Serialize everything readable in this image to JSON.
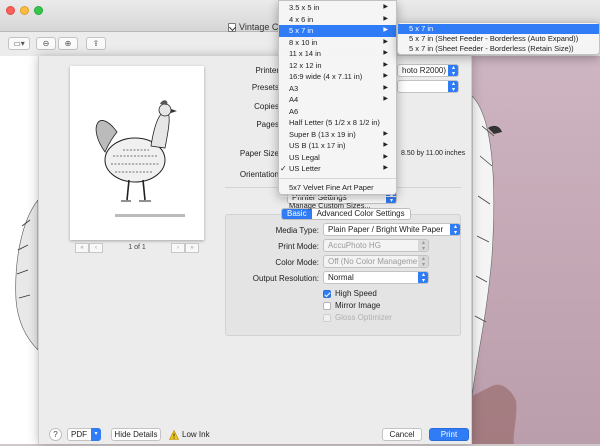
{
  "window": {
    "title": "Vintage Chick",
    "colors": {
      "accent": "#2f7cf6",
      "close": "#fc605c",
      "minimize": "#fdbc40",
      "maximize": "#34c84a"
    }
  },
  "preview": {
    "page_indicator": "1 of 1"
  },
  "form": {
    "printer_label": "Printer",
    "printer_value": "hoto R2000)",
    "presets_label": "Presets",
    "copies_label": "Copies",
    "pages_label": "Pages",
    "paper_size_label": "Paper Size",
    "paper_size_dimensions": "8.50 by 11.00 inches",
    "orientation_label": "Orientation",
    "section_value": "Printer Settings"
  },
  "tabs": {
    "basic": "Basic",
    "advanced": "Advanced Color Settings"
  },
  "settings": {
    "media_type_label": "Media Type:",
    "media_type_value": "Plain Paper / Bright White Paper",
    "print_mode_label": "Print Mode:",
    "print_mode_value": "AccuPhoto HG",
    "color_mode_label": "Color Mode:",
    "color_mode_value": "Off (No Color Manageme...",
    "output_resolution_label": "Output Resolution:",
    "output_resolution_value": "Normal",
    "high_speed": "High Speed",
    "mirror_image": "Mirror Image",
    "gloss_optimizer": "Gloss Optimizer"
  },
  "bottom": {
    "help": "?",
    "pdf": "PDF",
    "hide_details": "Hide Details",
    "low_ink": "Low Ink",
    "cancel": "Cancel",
    "print": "Print"
  },
  "paper_menu": {
    "items": [
      {
        "label": "3.5 x 5 in",
        "submenu": true
      },
      {
        "label": "4 x 6 in",
        "submenu": true
      },
      {
        "label": "5 x 7 in",
        "submenu": true,
        "selected": true
      },
      {
        "label": "8 x 10 in",
        "submenu": true
      },
      {
        "label": "11 x 14 in",
        "submenu": true
      },
      {
        "label": "12 x 12 in",
        "submenu": true
      },
      {
        "label": "16:9 wide (4 x 7.11 in)",
        "submenu": true
      },
      {
        "label": "A3",
        "submenu": true
      },
      {
        "label": "A4",
        "submenu": true
      },
      {
        "label": "A6",
        "submenu": false
      },
      {
        "label": "Half Letter (5 1/2 x 8 1/2 in)",
        "submenu": false
      },
      {
        "label": "Super B (13 x 19 in)",
        "submenu": true
      },
      {
        "label": "US B (11 x 17 in)",
        "submenu": true
      },
      {
        "label": "US Legal",
        "submenu": true
      },
      {
        "label": "US Letter",
        "submenu": true,
        "checked": true
      }
    ],
    "custom_items": [
      "5x7 Velvet Fine Art Paper"
    ],
    "manage_item": "Manage Custom Sizes..."
  },
  "size_submenu": {
    "items": [
      {
        "label": "5 x 7 in",
        "selected": true
      },
      {
        "label": "5 x 7 in (Sheet Feeder - Borderless (Auto Expand))"
      },
      {
        "label": "5 x 7 in (Sheet Feeder - Borderless (Retain Size))"
      }
    ]
  }
}
